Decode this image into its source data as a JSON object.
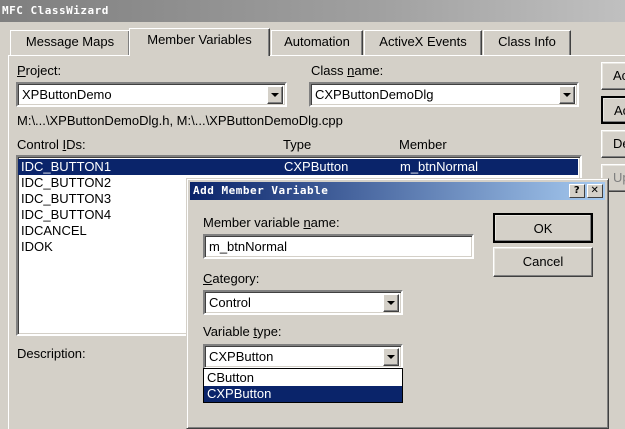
{
  "window": {
    "title": "MFC ClassWizard"
  },
  "tabs": [
    {
      "label": "Message Maps"
    },
    {
      "label": "Member Variables"
    },
    {
      "label": "Automation"
    },
    {
      "label": "ActiveX Events"
    },
    {
      "label": "Class Info"
    }
  ],
  "project": {
    "label_prefix": "P",
    "label_rest": "roject:",
    "value": "XPButtonDemo"
  },
  "class_name": {
    "label_pre": "Class ",
    "label_u": "n",
    "label_rest": "ame:",
    "value": "CXPButtonDemoDlg"
  },
  "file_path": "M:\\...\\XPButtonDemoDlg.h, M:\\...\\XPButtonDemoDlg.cpp",
  "list": {
    "header_control_pre": "Control ",
    "header_control_u": "I",
    "header_control_rest": "Ds:",
    "header_type": "Type",
    "header_member": "Member",
    "rows": [
      {
        "id": "IDC_BUTTON1",
        "type": "CXPButton",
        "member": "m_btnNormal"
      },
      {
        "id": "IDC_BUTTON2",
        "type": "",
        "member": ""
      },
      {
        "id": "IDC_BUTTON3",
        "type": "",
        "member": ""
      },
      {
        "id": "IDC_BUTTON4",
        "type": "",
        "member": ""
      },
      {
        "id": "IDCANCEL",
        "type": "",
        "member": ""
      },
      {
        "id": "IDOK",
        "type": "",
        "member": ""
      }
    ]
  },
  "description_label": "Description:",
  "side_buttons": [
    {
      "label": "Ac"
    },
    {
      "label": "Ac"
    },
    {
      "label": "De"
    },
    {
      "label": "Up"
    }
  ],
  "dialog": {
    "title": "Add Member Variable",
    "help_glyph": "?",
    "close_glyph": "✕",
    "member_name_label_pre": "Member variable ",
    "member_name_label_u": "n",
    "member_name_label_rest": "ame:",
    "member_name_value": "m_btnNormal",
    "category_label_u": "C",
    "category_label_rest": "ategory:",
    "category_value": "Control",
    "variable_type_label_pre": "Variable ",
    "variable_type_label_u": "t",
    "variable_type_label_rest": "ype:",
    "variable_type_value": "CXPButton",
    "variable_type_options": [
      "CButton",
      "CXPButton"
    ],
    "ok_label": "OK",
    "cancel_label": "Cancel"
  },
  "colors": {
    "selection": "#0a246a",
    "face": "#d4d0c8"
  }
}
